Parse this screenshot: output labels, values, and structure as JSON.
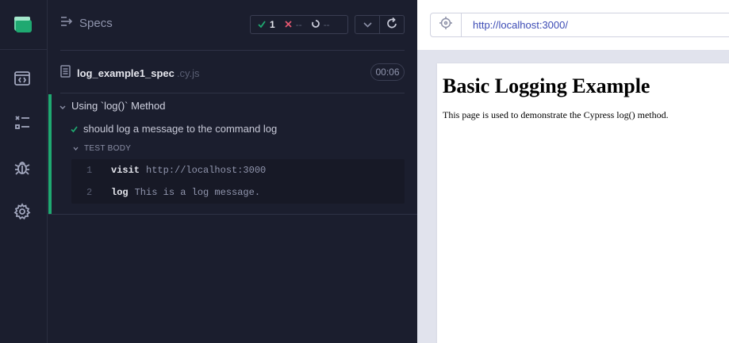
{
  "nav": {
    "items": [
      "specs",
      "runs",
      "debug",
      "settings"
    ]
  },
  "reporter": {
    "specs_label": "Specs",
    "stats": {
      "passed": "1",
      "failed": "--",
      "pending": "--"
    },
    "spec": {
      "name": "log_example1_spec",
      "ext": ".cy.js",
      "duration": "00:06"
    },
    "suite": {
      "title": "Using `log()` Method",
      "test": "should log a message to the command log",
      "body_label": "TEST BODY",
      "commands": [
        {
          "num": "1",
          "name": "visit",
          "message": "http://localhost:3000"
        },
        {
          "num": "2",
          "name": "log",
          "message": "This is a log message."
        }
      ]
    }
  },
  "browser": {
    "url": "http://localhost:3000/"
  },
  "aut": {
    "heading": "Basic Logging Example",
    "paragraph": "This page is used to demonstrate the Cypress log() method."
  },
  "colors": {
    "pass": "#1fa971",
    "fail": "#e45770",
    "url": "#3c4bb5"
  }
}
